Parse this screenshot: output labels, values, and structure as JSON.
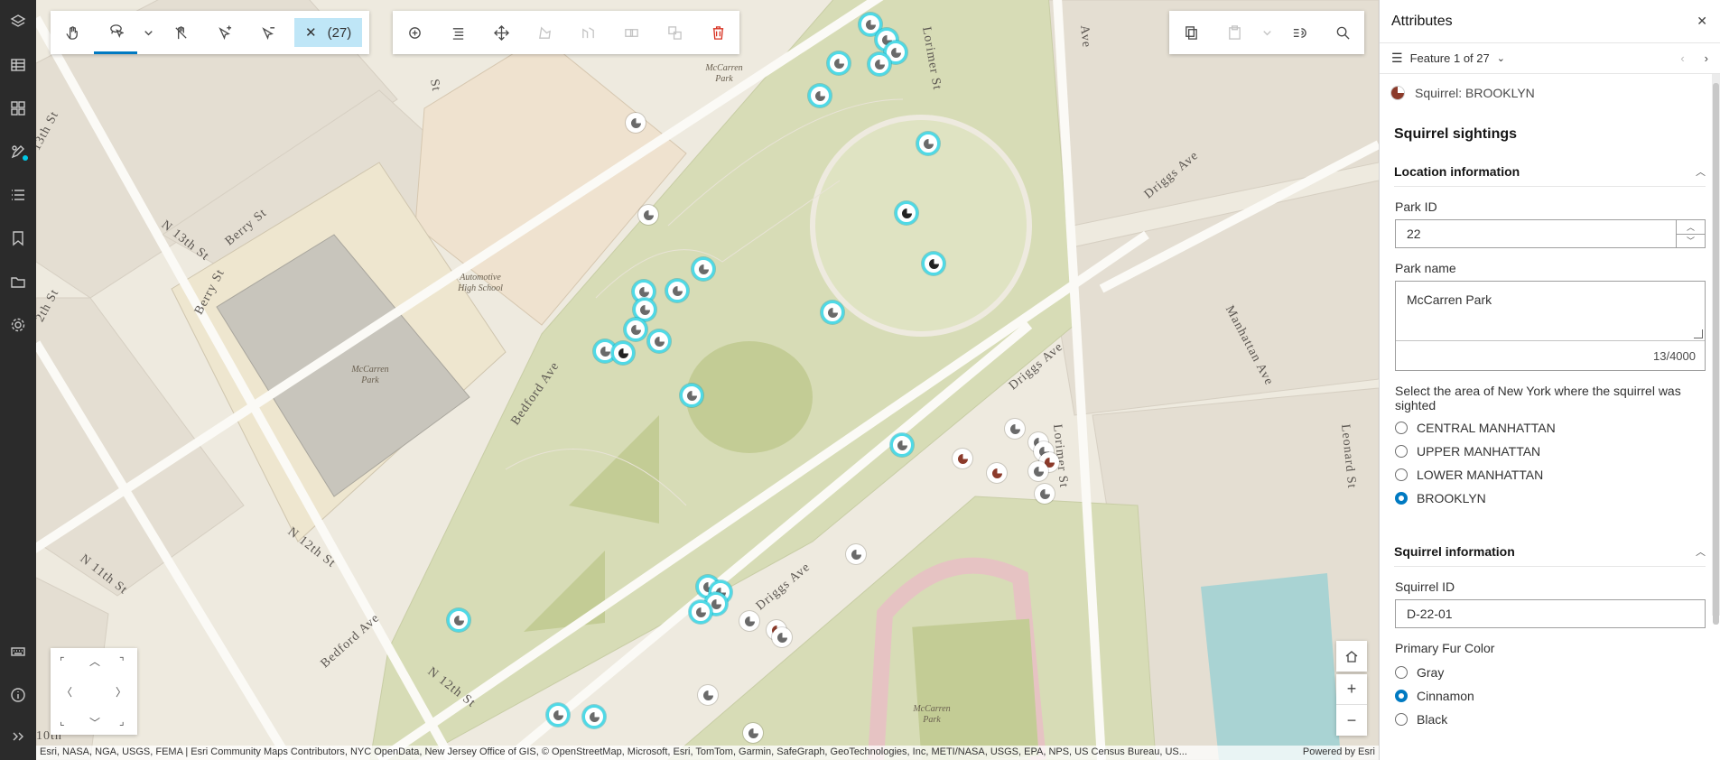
{
  "rail": {
    "items": [
      "layers-icon",
      "table-icon",
      "grid-icon",
      "edit-icon",
      "list-icon",
      "bookmark-icon",
      "folder-icon",
      "settings-icon",
      "keyboard-icon",
      "info-icon",
      "expand-icon"
    ]
  },
  "toolbar": {
    "selection_label": "(27)"
  },
  "map": {
    "streets": [
      "Lorimer St",
      "Berry St",
      "N 13th St",
      "N 12th St",
      "N 11th St",
      "Bedford Ave",
      "Driggs Ave",
      "Manhattan Ave",
      "Lorimer St",
      "Leonard St",
      "13th St",
      "2th St",
      "N 12th St",
      "Berry St",
      "Bedford Ave",
      "N 13th St",
      "Driggs Ave",
      "Ave",
      "Ave",
      "St",
      "10th"
    ],
    "places": [
      "McCarren\nPark",
      "Automotive\nHigh School",
      "McCarren\nPark",
      "McCarren\nPark"
    ],
    "attribution": "Esri, NASA, NGA, USGS, FEMA | Esri Community Maps Contributors, NYC OpenData, New Jersey Office of GIS, © OpenStreetMap, Microsoft, Esri, TomTom, Garmin, SafeGraph, GeoTechnologies, Inc, METI/NASA, USGS, EPA, NPS, US Census Bureau, US...",
    "powered_by": "Powered by Esri"
  },
  "panel": {
    "title": "Attributes",
    "nav_label": "Feature 1 of 27",
    "feature_name": "Squirrel: BROOKLYN",
    "form_title": "Squirrel sightings",
    "location_group": "Location information",
    "park_id_label": "Park ID",
    "park_id_value": "22",
    "park_name_label": "Park name",
    "park_name_value": "McCarren Park",
    "park_name_count": "13/4000",
    "area_question": "Select the area of New York where the squirrel was sighted",
    "area_options": [
      "CENTRAL MANHATTAN",
      "UPPER MANHATTAN",
      "LOWER MANHATTAN",
      "BROOKLYN"
    ],
    "area_selected": "BROOKLYN",
    "squirrel_group": "Squirrel information",
    "squirrel_id_label": "Squirrel ID",
    "squirrel_id_value": "D-22-01",
    "fur_label": "Primary Fur Color",
    "fur_options": [
      "Gray",
      "Cinnamon",
      "Black"
    ],
    "fur_selected": "Cinnamon"
  }
}
